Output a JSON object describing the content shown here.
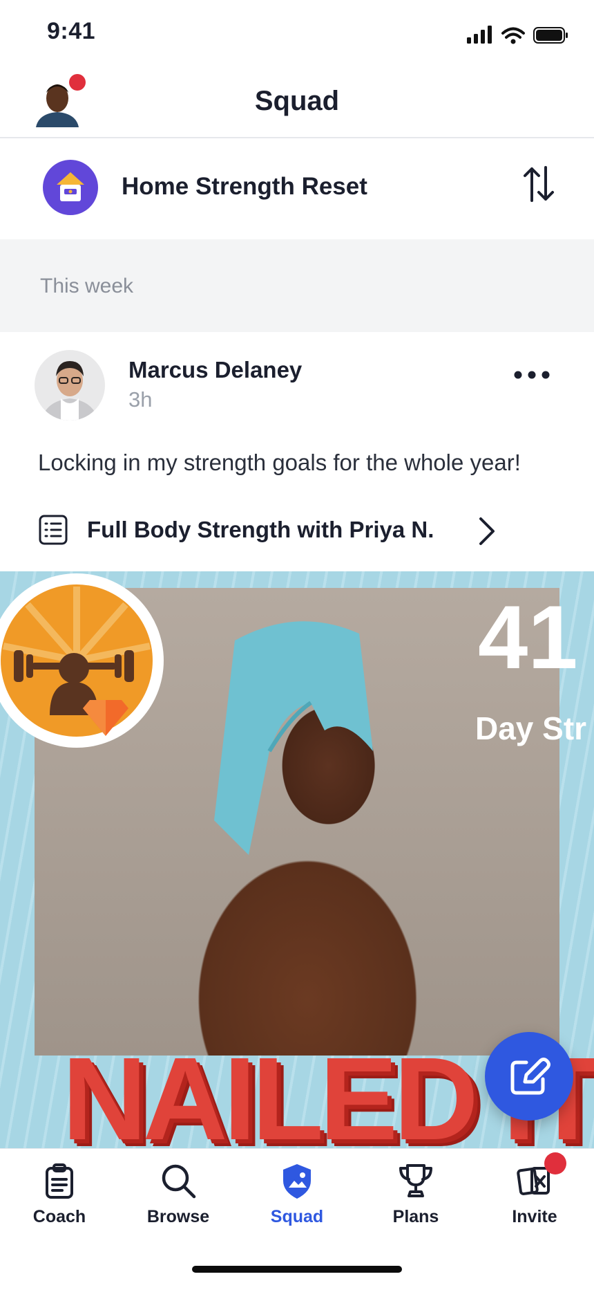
{
  "status_bar": {
    "time": "9:41"
  },
  "header": {
    "title": "Squad"
  },
  "program": {
    "name": "Home Strength Reset"
  },
  "section": {
    "label": "This week"
  },
  "post": {
    "author": "Marcus Delaney",
    "time": "3h",
    "text": "Locking in my strength goals for the whole year!",
    "workout": "Full Body Strength with Priya N.",
    "streak_number": "41",
    "streak_label": "Day Str",
    "banner_text": "NAILED IT"
  },
  "tabs": [
    {
      "label": "Coach",
      "icon": "clipboard-icon"
    },
    {
      "label": "Browse",
      "icon": "search-icon"
    },
    {
      "label": "Squad",
      "icon": "squad-shield-icon",
      "active": true
    },
    {
      "label": "Plans",
      "icon": "trophy-icon"
    },
    {
      "label": "Invite",
      "icon": "invite-cards-icon"
    }
  ],
  "colors": {
    "accent": "#2f58e0",
    "notification": "#e02f3c",
    "program_icon": "#6147d9",
    "banner": "#e0433a"
  }
}
